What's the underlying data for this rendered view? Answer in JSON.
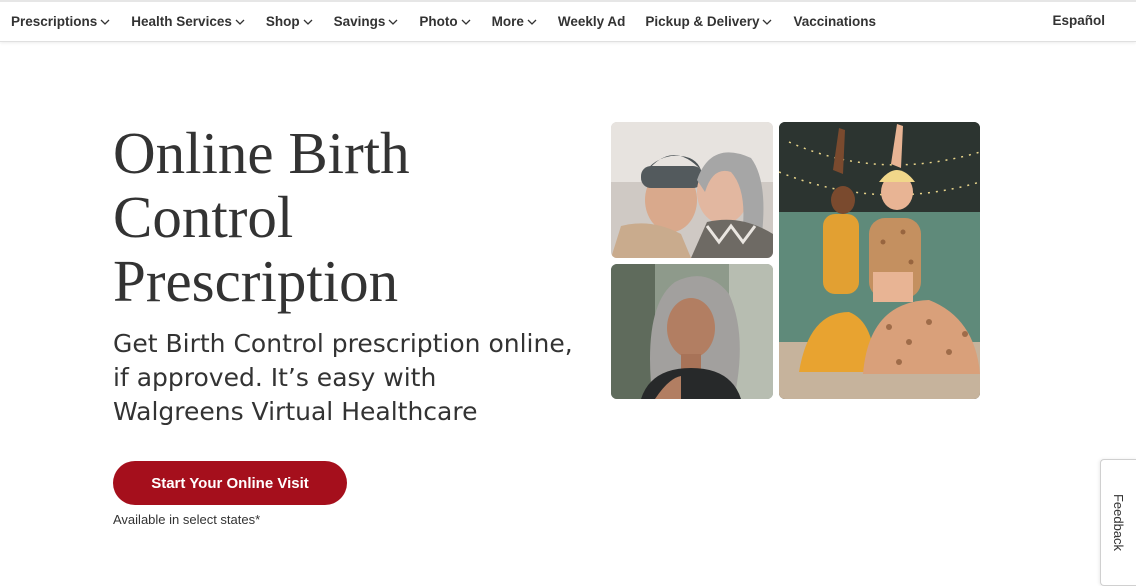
{
  "nav": {
    "items": [
      {
        "label": "Prescriptions",
        "has_dropdown": true
      },
      {
        "label": "Health Services",
        "has_dropdown": true
      },
      {
        "label": "Shop",
        "has_dropdown": true
      },
      {
        "label": "Savings",
        "has_dropdown": true
      },
      {
        "label": "Photo",
        "has_dropdown": true
      },
      {
        "label": "More",
        "has_dropdown": true
      },
      {
        "label": "Weekly Ad",
        "has_dropdown": false
      },
      {
        "label": "Pickup & Delivery",
        "has_dropdown": true
      },
      {
        "label": "Vaccinations",
        "has_dropdown": false
      }
    ],
    "language_link": "Español"
  },
  "hero": {
    "title": "Online Birth Control Prescription",
    "subtitle": "Get Birth Control prescription online, if approved. It’s easy with Walgreens Virtual Healthcare",
    "cta_label": "Start Your Online Visit",
    "availability_note": "Available in select states*"
  },
  "images": [
    {
      "icon": "photo-couple-embrace"
    },
    {
      "icon": "photo-woman-portrait"
    },
    {
      "icon": "photo-friends-yoga"
    }
  ],
  "feedback": {
    "label": "Feedback"
  },
  "colors": {
    "brand_red": "#a50f1c",
    "text": "#333333"
  }
}
